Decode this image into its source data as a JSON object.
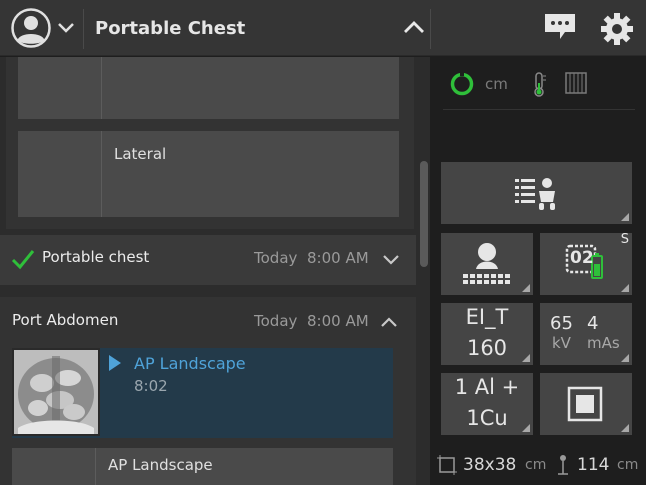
{
  "header": {
    "title": "Portable Chest"
  },
  "exams": {
    "card_lateral_label": "Lateral",
    "portable_chest": {
      "name": "Portable chest",
      "date": "Today",
      "time": "8:00 AM"
    },
    "port_abdomen": {
      "name": "Port Abdomen",
      "date": "Today",
      "time": "8:00 AM",
      "active_view": {
        "label": "AP Landscape",
        "time": "8:02"
      },
      "next_view_label": "AP Landscape"
    }
  },
  "status": {
    "distance_unit": "cm"
  },
  "controls": {
    "detector_badge": "02",
    "detector_suffix": "S",
    "ei_label": "EI_T",
    "ei_value": "160",
    "kv_value": "65",
    "kv_unit": "kV",
    "mas_value": "4",
    "mas_unit": "mAs",
    "filter_line1": "1 Al +",
    "filter_line2": "1Cu"
  },
  "footer": {
    "field_size": "38x38",
    "field_unit": "cm",
    "sid_value": "114",
    "sid_unit": "cm"
  },
  "colors": {
    "accent_green": "#2fbf3a",
    "active_blue": "#4fa3d9"
  }
}
